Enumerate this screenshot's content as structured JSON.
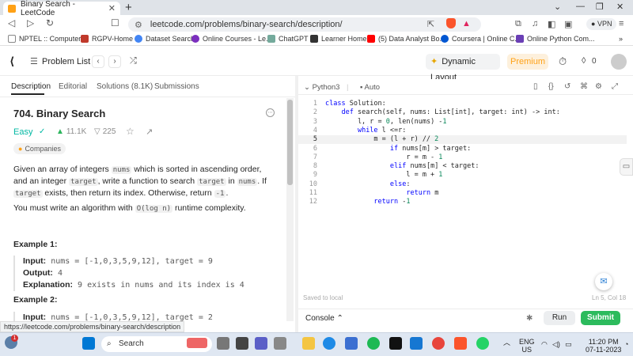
{
  "browser": {
    "tab_title": "Binary Search - LeetCode",
    "url": "leetcode.com/problems/binary-search/description/",
    "vpn_label": "VPN",
    "status_url": "https://leetcode.com/problems/binary-search/description",
    "bookmarks": [
      "NPTEL :: Computer...",
      "RGPV-Home",
      "Dataset Search",
      "Online Courses - Le...",
      "ChatGPT",
      "Learner Home",
      "(5) Data Analyst Bo...",
      "Coursera | Online C...",
      "Online Python Com..."
    ]
  },
  "header": {
    "problem_list": "Problem List",
    "dynamic_layout": "Dynamic Layout",
    "premium": "Premium",
    "streak_count": "0"
  },
  "left": {
    "tabs": [
      "Description",
      "Editorial",
      "Solutions (8.1K)",
      "Submissions"
    ],
    "title": "704. Binary Search",
    "difficulty": "Easy",
    "likes": "11.1K",
    "dislikes": "225",
    "companies": "Companies",
    "desc1_a": "Given an array of integers ",
    "desc1_code1": "nums",
    "desc1_b": " which is sorted in ascending order, and an integer ",
    "desc1_code2": "target",
    "desc1_c": ", write a function to search ",
    "desc1_code3": "target",
    "desc1_d": " in ",
    "desc1_code4": "nums",
    "desc1_e": ". If ",
    "desc1_code5": "target",
    "desc1_f": " exists, then return its index. Otherwise, return ",
    "desc1_code6": "-1",
    "desc1_g": ".",
    "desc2_a": "You must write an algorithm with ",
    "desc2_code": "O(log n)",
    "desc2_b": " runtime complexity.",
    "ex1_title": "Example 1:",
    "ex1_input_label": "Input:",
    "ex1_input": "nums = [-1,0,3,5,9,12], target = 9",
    "ex1_output_label": "Output:",
    "ex1_output": "4",
    "ex1_expl_label": "Explanation:",
    "ex1_expl": "9 exists in nums and its index is 4",
    "ex2_title": "Example 2:",
    "ex2_input_label": "Input:",
    "ex2_input": "nums = [-1,0,3,5,9,12], target = 2"
  },
  "editor": {
    "language": "Python3",
    "auto": "Auto",
    "saved": "Saved to local",
    "cursor_pos": "Ln 5, Col 18",
    "console": "Console",
    "run": "Run",
    "submit": "Submit",
    "lines": [
      {
        "n": "1",
        "code": "class Solution:"
      },
      {
        "n": "2",
        "code": "    def search(self, nums: List[int], target: int) -> int:"
      },
      {
        "n": "3",
        "code": "        l, r = 0, len(nums) -1"
      },
      {
        "n": "4",
        "code": "        while l <=r:"
      },
      {
        "n": "5",
        "code": "            m = (l + r) // 2"
      },
      {
        "n": "6",
        "code": "                if nums[m] > target:"
      },
      {
        "n": "7",
        "code": "                    r = m - 1"
      },
      {
        "n": "8",
        "code": "                elif nums[m] < target:"
      },
      {
        "n": "9",
        "code": "                    l = m + 1"
      },
      {
        "n": "10",
        "code": "                else:"
      },
      {
        "n": "11",
        "code": "                    return m"
      },
      {
        "n": "12",
        "code": "            return -1"
      }
    ]
  },
  "taskbar": {
    "search": "Search",
    "lang": "ENG",
    "region": "US",
    "time": "11:20 PM",
    "date": "07-11-2023",
    "notification_count": "1"
  }
}
